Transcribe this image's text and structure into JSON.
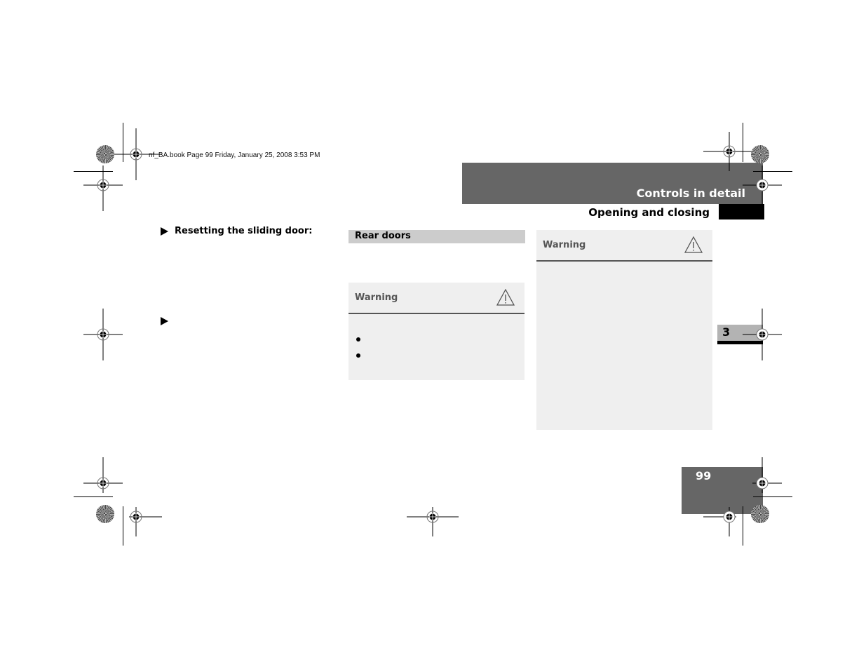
{
  "print_slug": "nf_BA.book  Page 99  Friday, January 25, 2008  3:53 PM",
  "header": {
    "chapter_title": "Controls in detail",
    "section_title": "Opening and closing"
  },
  "left_column": {
    "steps": [
      {
        "icon": "triangle-right-bullet",
        "text": "Resetting the sliding door:"
      },
      {
        "icon": "triangle-right-bullet",
        "text": ""
      }
    ]
  },
  "middle_column": {
    "section_heading": "Rear doors",
    "warning": {
      "label": "Warning",
      "icon": "warning-triangle-icon",
      "bullets": [
        "",
        ""
      ]
    }
  },
  "right_column": {
    "warning": {
      "label": "Warning",
      "icon": "warning-triangle-icon"
    }
  },
  "side_tab": {
    "chapter_number": "3"
  },
  "footer": {
    "page_number": "99"
  },
  "colors": {
    "header_gray": "#666666",
    "section_bar_gray": "#cccccc",
    "warning_box_bg": "#efefef",
    "chapter_tab_gray": "#b3b3b3"
  }
}
